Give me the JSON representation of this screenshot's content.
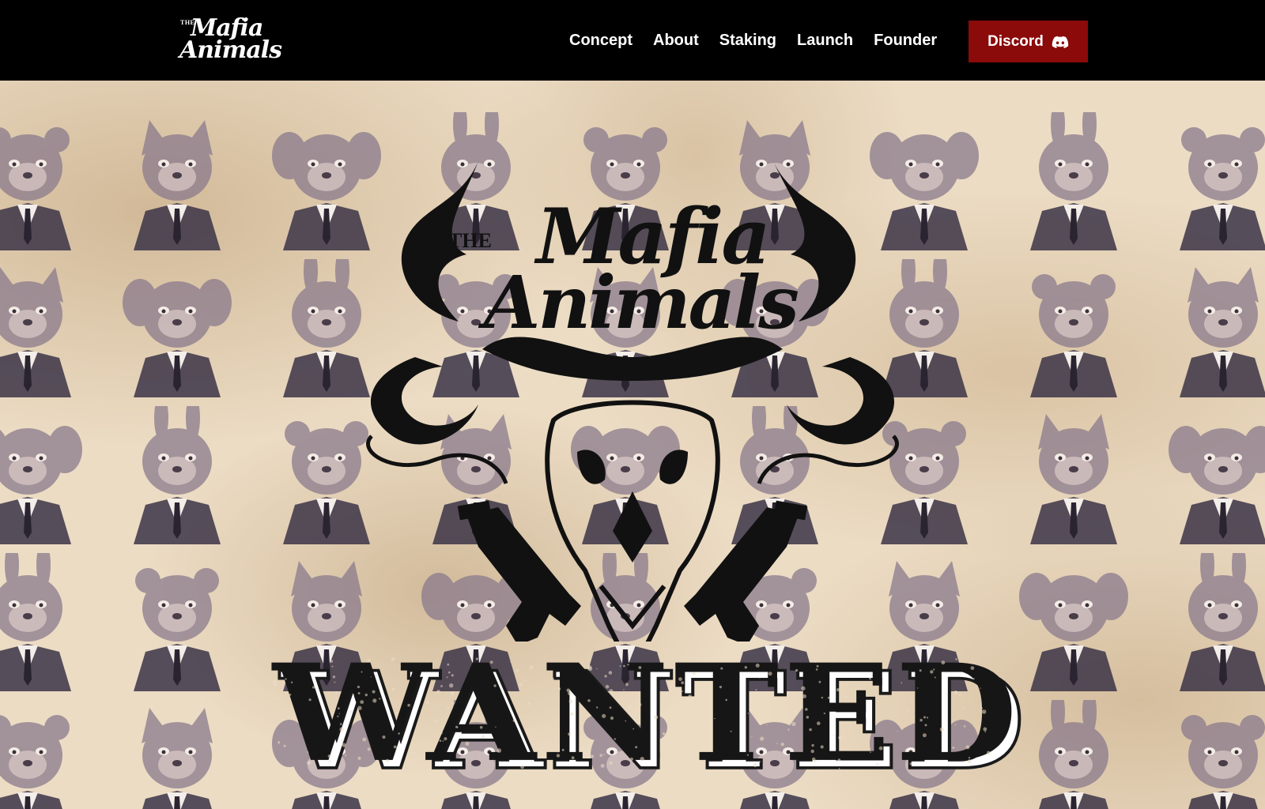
{
  "header": {
    "logo": {
      "line_the": "THE",
      "line1": "Mafia",
      "line2": "Animals"
    },
    "nav": [
      {
        "label": "Concept"
      },
      {
        "label": "About"
      },
      {
        "label": "Staking"
      },
      {
        "label": "Launch"
      },
      {
        "label": "Founder"
      }
    ],
    "discord_button": {
      "label": "Discord",
      "icon": "discord-icon"
    }
  },
  "hero": {
    "background_pattern": "mafia-animal-portraits",
    "emblem": {
      "the": "THE",
      "line1": "Mafia",
      "line2": "Animals",
      "icons": [
        "skull-icon",
        "horns-icon",
        "pistol-icon"
      ]
    },
    "wanted": "WANTED"
  },
  "colors": {
    "header_bg": "#000000",
    "button_bg": "#8b0a0a",
    "paper_bg": "#ecdcc4",
    "suit": "#3b3446",
    "portrait_tint": "#8a7a8c",
    "ink": "#111111"
  }
}
